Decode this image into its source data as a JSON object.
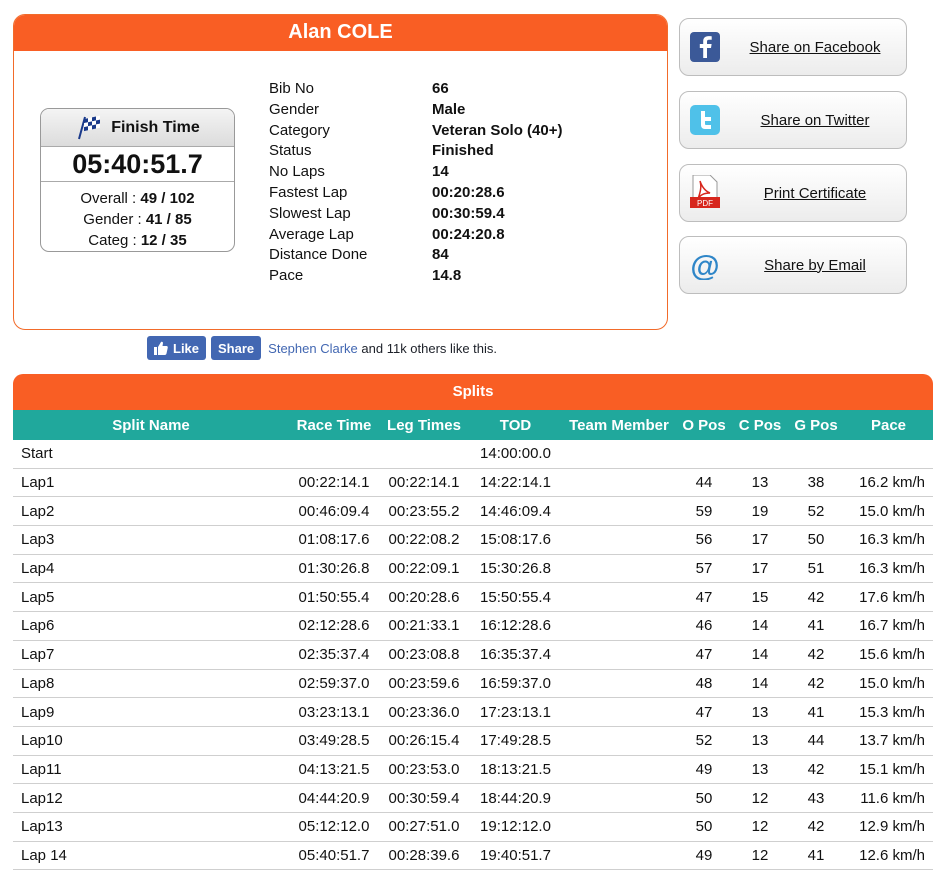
{
  "athlete": {
    "name": "Alan COLE",
    "finish_label": "Finish Time",
    "finish_time": "05:40:51.7",
    "ranks": [
      {
        "label": "Overall : ",
        "value": "49 / 102"
      },
      {
        "label": "Gender : ",
        "value": "41 / 85"
      },
      {
        "label": "Categ : ",
        "value": "12 / 35"
      }
    ],
    "details": [
      {
        "label": "Bib No",
        "value": "66"
      },
      {
        "label": "Gender",
        "value": "Male"
      },
      {
        "label": "Category",
        "value": "Veteran Solo (40+)"
      },
      {
        "label": "Status",
        "value": "Finished"
      },
      {
        "label": "No Laps",
        "value": "14"
      },
      {
        "label": "Fastest Lap",
        "value": "00:20:28.6"
      },
      {
        "label": "Slowest Lap",
        "value": "00:30:59.4"
      },
      {
        "label": "Average Lap",
        "value": "00:24:20.8"
      },
      {
        "label": "Distance Done",
        "value": "84"
      },
      {
        "label": "Pace",
        "value": "14.8"
      }
    ]
  },
  "share": {
    "facebook": "Share on Facebook",
    "twitter": "Share on Twitter",
    "certificate": "Print Certificate",
    "certificate_icon_text": "PDF",
    "email": "Share by Email"
  },
  "social": {
    "like": "Like",
    "share": "Share",
    "friend": "Stephen Clarke",
    "rest": " and 11k others like this."
  },
  "splits": {
    "title": "Splits",
    "columns": [
      "Split Name",
      "Race Time",
      "Leg Times",
      "TOD",
      "Team Member",
      "O Pos",
      "C Pos",
      "G Pos",
      "Pace"
    ],
    "rows": [
      {
        "name": "Start",
        "race": "",
        "leg": "",
        "tod": "14:00:00.0",
        "team": "",
        "opos": "",
        "cpos": "",
        "gpos": "",
        "pace": ""
      },
      {
        "name": "Lap1",
        "race": "00:22:14.1",
        "leg": "00:22:14.1",
        "tod": "14:22:14.1",
        "team": "",
        "opos": "44",
        "cpos": "13",
        "gpos": "38",
        "pace": "16.2 km/h"
      },
      {
        "name": "Lap2",
        "race": "00:46:09.4",
        "leg": "00:23:55.2",
        "tod": "14:46:09.4",
        "team": "",
        "opos": "59",
        "cpos": "19",
        "gpos": "52",
        "pace": "15.0 km/h"
      },
      {
        "name": "Lap3",
        "race": "01:08:17.6",
        "leg": "00:22:08.2",
        "tod": "15:08:17.6",
        "team": "",
        "opos": "56",
        "cpos": "17",
        "gpos": "50",
        "pace": "16.3 km/h"
      },
      {
        "name": "Lap4",
        "race": "01:30:26.8",
        "leg": "00:22:09.1",
        "tod": "15:30:26.8",
        "team": "",
        "opos": "57",
        "cpos": "17",
        "gpos": "51",
        "pace": "16.3 km/h"
      },
      {
        "name": "Lap5",
        "race": "01:50:55.4",
        "leg": "00:20:28.6",
        "tod": "15:50:55.4",
        "team": "",
        "opos": "47",
        "cpos": "15",
        "gpos": "42",
        "pace": "17.6 km/h"
      },
      {
        "name": "Lap6",
        "race": "02:12:28.6",
        "leg": "00:21:33.1",
        "tod": "16:12:28.6",
        "team": "",
        "opos": "46",
        "cpos": "14",
        "gpos": "41",
        "pace": "16.7 km/h"
      },
      {
        "name": "Lap7",
        "race": "02:35:37.4",
        "leg": "00:23:08.8",
        "tod": "16:35:37.4",
        "team": "",
        "opos": "47",
        "cpos": "14",
        "gpos": "42",
        "pace": "15.6 km/h"
      },
      {
        "name": "Lap8",
        "race": "02:59:37.0",
        "leg": "00:23:59.6",
        "tod": "16:59:37.0",
        "team": "",
        "opos": "48",
        "cpos": "14",
        "gpos": "42",
        "pace": "15.0 km/h"
      },
      {
        "name": "Lap9",
        "race": "03:23:13.1",
        "leg": "00:23:36.0",
        "tod": "17:23:13.1",
        "team": "",
        "opos": "47",
        "cpos": "13",
        "gpos": "41",
        "pace": "15.3 km/h"
      },
      {
        "name": "Lap10",
        "race": "03:49:28.5",
        "leg": "00:26:15.4",
        "tod": "17:49:28.5",
        "team": "",
        "opos": "52",
        "cpos": "13",
        "gpos": "44",
        "pace": "13.7 km/h"
      },
      {
        "name": "Lap11",
        "race": "04:13:21.5",
        "leg": "00:23:53.0",
        "tod": "18:13:21.5",
        "team": "",
        "opos": "49",
        "cpos": "13",
        "gpos": "42",
        "pace": "15.1 km/h"
      },
      {
        "name": "Lap12",
        "race": "04:44:20.9",
        "leg": "00:30:59.4",
        "tod": "18:44:20.9",
        "team": "",
        "opos": "50",
        "cpos": "12",
        "gpos": "43",
        "pace": "11.6 km/h"
      },
      {
        "name": "Lap13",
        "race": "05:12:12.0",
        "leg": "00:27:51.0",
        "tod": "19:12:12.0",
        "team": "",
        "opos": "50",
        "cpos": "12",
        "gpos": "42",
        "pace": "12.9 km/h"
      },
      {
        "name": "Lap 14",
        "race": "05:40:51.7",
        "leg": "00:28:39.6",
        "tod": "19:40:51.7",
        "team": "",
        "opos": "49",
        "cpos": "12",
        "gpos": "41",
        "pace": "12.6 km/h"
      }
    ]
  },
  "colors": {
    "orange": "#f95e24",
    "teal": "#20a89c",
    "facebook": "#4267b2"
  }
}
